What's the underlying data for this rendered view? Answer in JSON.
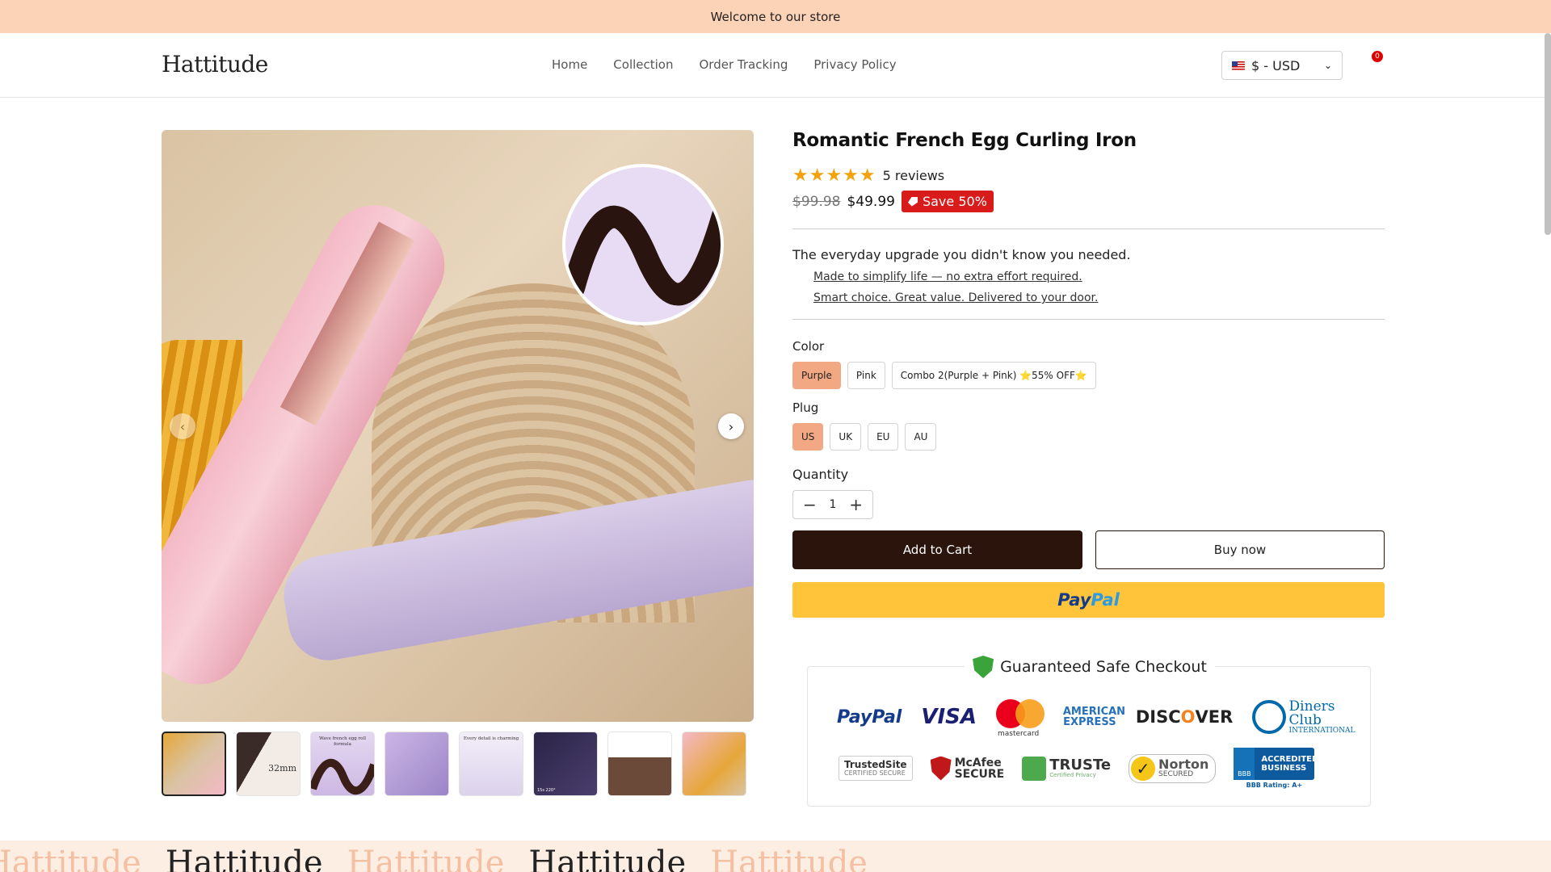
{
  "announcement": "Welcome to our store",
  "header": {
    "logo": "Hattitude",
    "nav": [
      "Home",
      "Collection",
      "Order Tracking",
      "Privacy Policy"
    ],
    "currency": "$ - USD",
    "cart_count": "0"
  },
  "product": {
    "title": "Romantic French Egg Curling Iron",
    "reviews": "5 reviews",
    "rating": 5,
    "compare_price": "$99.98",
    "price": "$49.99",
    "save": "Save 50%",
    "tagline": "The everyday upgrade you didn't know you needed.",
    "bullets": [
      "Made to simplify life — no extra effort required.",
      "Smart choice. Great value. Delivered to your door."
    ],
    "color_label": "Color",
    "colors": [
      "Purple",
      "Pink",
      "Combo 2(Purple + Pink) ⭐55% OFF⭐"
    ],
    "plug_label": "Plug",
    "plugs": [
      "US",
      "UK",
      "EU",
      "AU"
    ],
    "quantity_label": "Quantity",
    "quantity": "1",
    "add_to_cart": "Add to Cart",
    "buy_now": "Buy now",
    "paypal_a": "Pay",
    "paypal_b": "Pal"
  },
  "gallery": {
    "thumbs": [
      {
        "label": "",
        "big": "",
        "cap": ""
      },
      {
        "label": "",
        "big": "32mm",
        "cap": ""
      },
      {
        "label": "Wave french egg roll formula",
        "big": "",
        "cap": ""
      },
      {
        "label": "",
        "big": "",
        "cap": ""
      },
      {
        "label": "Every detail is charming",
        "big": "",
        "cap": ""
      },
      {
        "label": "",
        "big": "",
        "cap": "15s   220°"
      },
      {
        "label": "",
        "big": "",
        "cap": ""
      },
      {
        "label": "",
        "big": "",
        "cap": ""
      }
    ]
  },
  "safe_checkout": {
    "title": "Guaranteed Safe Checkout",
    "paypal": "PayPal",
    "visa": "VISA",
    "mastercard": "mastercard",
    "amex": "AMERICAN EXPRESS",
    "discover_a": "DISC",
    "discover_b": "O",
    "discover_c": "VER",
    "diners": "Diners Club",
    "diners_sub": "INTERNATIONAL",
    "trustedsite": "TrustedSite",
    "trustedsite_sub": "CERTIFIED SECURE",
    "mcafee": "McAfee",
    "mcafee_sub": "SECURE",
    "truste": "TRUSTe",
    "truste_sub": "Certified Privacy",
    "norton": "Norton",
    "norton_sub": "SECURED",
    "bbb_logo": "BBB",
    "bbb": "ACCREDITED BUSINESS",
    "bbb_rating": "BBB Rating: A+"
  },
  "marquee": [
    "Hattitude",
    "Hattitude",
    "Hattitude",
    "Hattitude",
    "Hattitude"
  ],
  "colors": {
    "announce_bg": "#fdd3b8",
    "selected_option": "#f2a882",
    "add_to_cart_bg": "#2a140c",
    "paypal_bg": "#ffc43a",
    "save_badge": "#d81b1b",
    "star": "#f2a20c"
  }
}
